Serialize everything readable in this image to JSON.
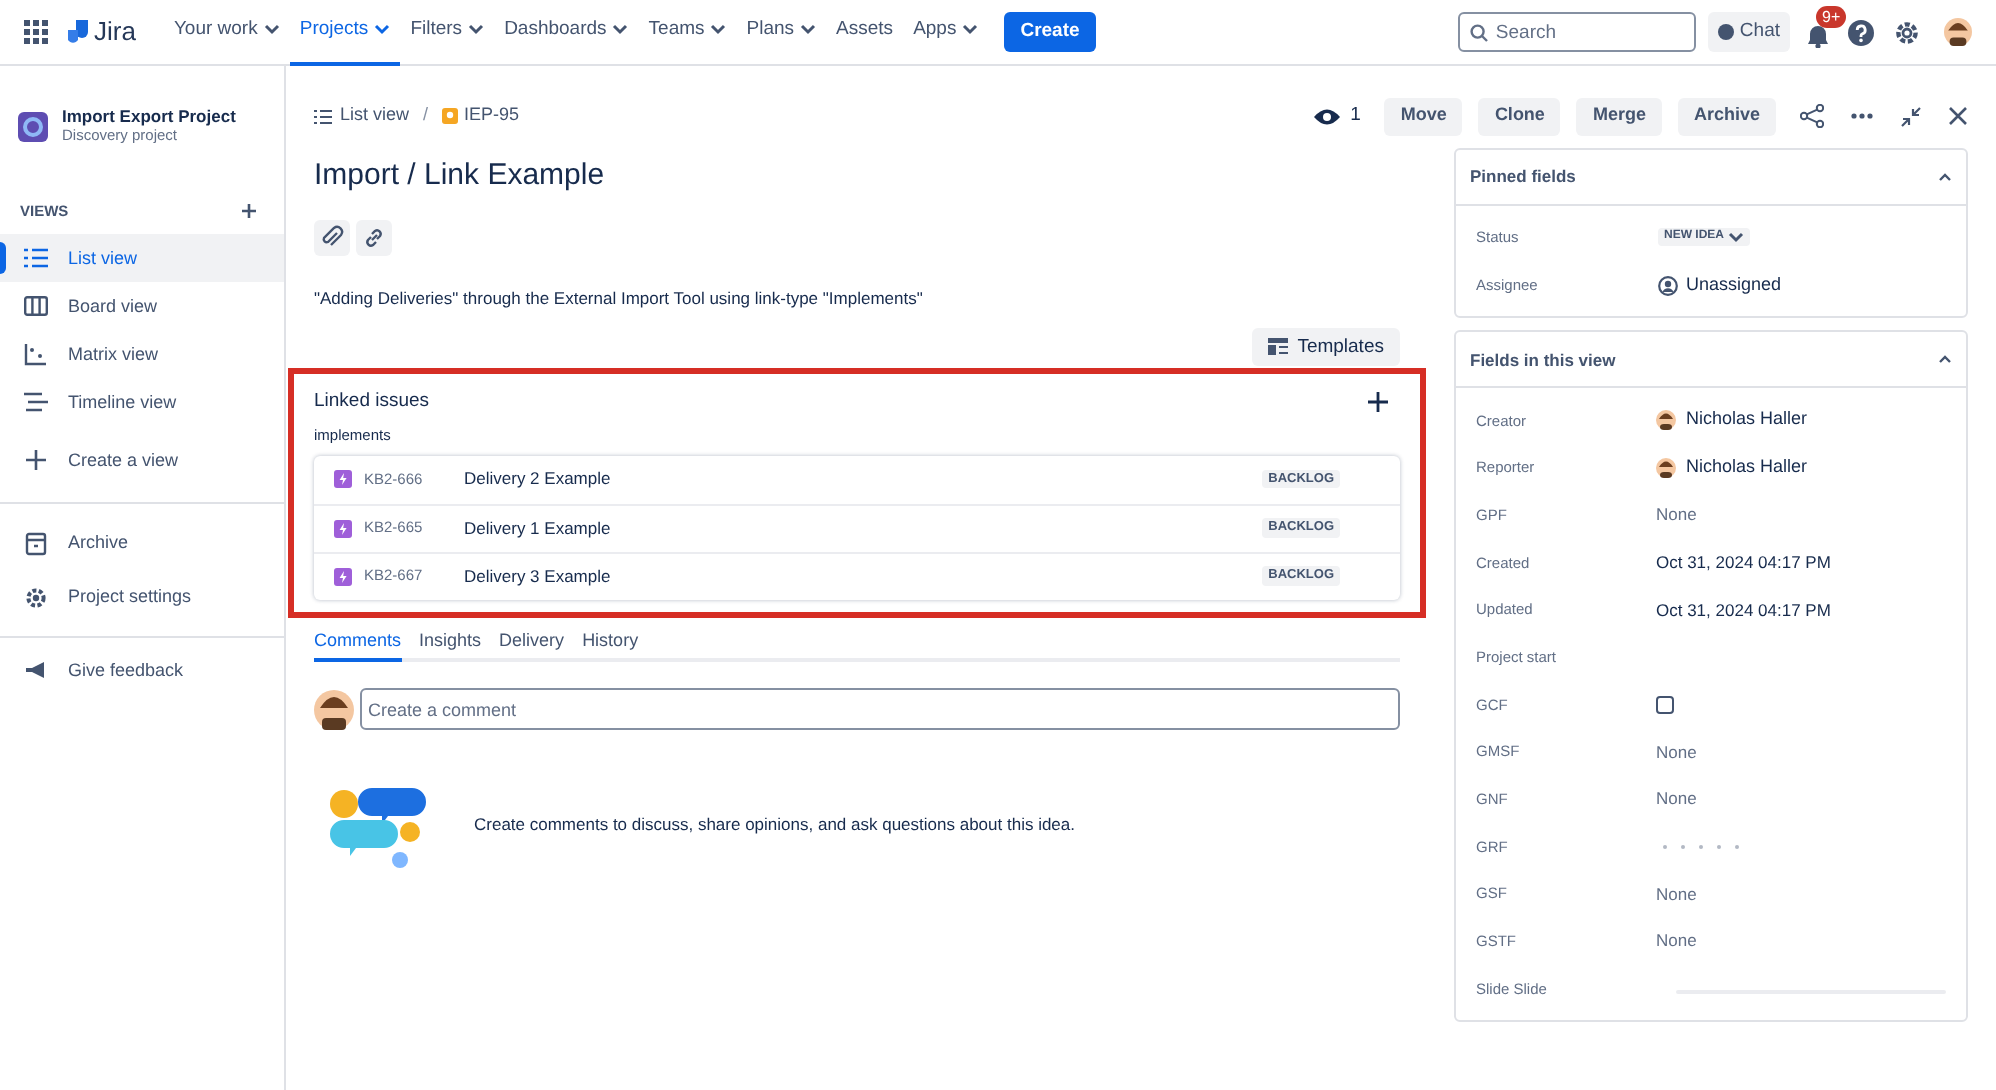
{
  "topnav": {
    "product": "Jira",
    "items": [
      {
        "label": "Your work",
        "dropdown": true,
        "selected": false
      },
      {
        "label": "Projects",
        "dropdown": true,
        "selected": true
      },
      {
        "label": "Filters",
        "dropdown": true,
        "selected": false
      },
      {
        "label": "Dashboards",
        "dropdown": true,
        "selected": false
      },
      {
        "label": "Teams",
        "dropdown": true,
        "selected": false
      },
      {
        "label": "Plans",
        "dropdown": true,
        "selected": false
      },
      {
        "label": "Assets",
        "dropdown": false,
        "selected": false
      },
      {
        "label": "Apps",
        "dropdown": true,
        "selected": false
      }
    ],
    "create": "Create",
    "search": {
      "placeholder": "Search"
    },
    "chat": "Chat",
    "notifications": "9+"
  },
  "sidebar": {
    "project": {
      "name": "Import Export Project",
      "type": "Discovery project"
    },
    "section": "VIEWS",
    "views": [
      {
        "kind": "list",
        "label": "List view",
        "selected": true
      },
      {
        "kind": "board",
        "label": "Board view",
        "selected": false
      },
      {
        "kind": "matrix",
        "label": "Matrix view",
        "selected": false
      },
      {
        "kind": "timeline",
        "label": "Timeline view",
        "selected": false
      },
      {
        "kind": "create",
        "label": "Create a view",
        "selected": false
      }
    ],
    "links": [
      {
        "kind": "archive",
        "label": "Archive"
      },
      {
        "kind": "settings",
        "label": "Project settings"
      }
    ],
    "feedback": "Give feedback"
  },
  "breadcrumb": {
    "view": "List view",
    "separator": "/",
    "issue": "IEP-95"
  },
  "watchers": "1",
  "actions": [
    "Move",
    "Clone",
    "Merge",
    "Archive"
  ],
  "title": "Import / Link Example",
  "description": "\"Adding Deliveries\" through the External Import Tool using link-type \"Implements\"",
  "templates": "Templates",
  "linked_issues": {
    "highlighted": true,
    "title": "Linked issues",
    "link_type": "implements",
    "issues": [
      {
        "key": "KB2-666",
        "summary": "Delivery 2 Example",
        "status": "BACKLOG"
      },
      {
        "key": "KB2-665",
        "summary": "Delivery 1 Example",
        "status": "BACKLOG"
      },
      {
        "key": "KB2-667",
        "summary": "Delivery 3 Example",
        "status": "BACKLOG"
      }
    ]
  },
  "tabs": [
    {
      "label": "Comments",
      "selected": true
    },
    {
      "label": "Insights",
      "selected": false
    },
    {
      "label": "Delivery",
      "selected": false
    },
    {
      "label": "History",
      "selected": false
    }
  ],
  "comment": {
    "placeholder": "Create a comment"
  },
  "empty_comments": "Create comments to discuss, share opinions, and ask questions about this idea.",
  "pinned": {
    "title": "Pinned fields",
    "expanded": true,
    "fields": [
      {
        "kind": "status",
        "label": "Status",
        "value": "NEW IDEA"
      },
      {
        "kind": "assignee",
        "label": "Assignee",
        "value": "Unassigned"
      }
    ]
  },
  "view_fields": {
    "title": "Fields in this view",
    "expanded": true,
    "fields": [
      {
        "kind": "person",
        "label": "Creator",
        "value": "Nicholas Haller"
      },
      {
        "kind": "person",
        "label": "Reporter",
        "value": "Nicholas Haller"
      },
      {
        "kind": "text",
        "label": "GPF",
        "value": "None",
        "muted": true
      },
      {
        "kind": "text",
        "label": "Created",
        "value": "Oct 31, 2024 04:17 PM",
        "muted": false
      },
      {
        "kind": "text",
        "label": "Updated",
        "value": "Oct 31, 2024 04:17 PM",
        "muted": false
      },
      {
        "kind": "empty",
        "label": "Project start"
      },
      {
        "kind": "checkbox",
        "label": "GCF",
        "checked": false
      },
      {
        "kind": "text",
        "label": "GMSF",
        "value": "None",
        "muted": true
      },
      {
        "kind": "text",
        "label": "GNF",
        "value": "None",
        "muted": true
      },
      {
        "kind": "rating",
        "label": "GRF",
        "stars": 0
      },
      {
        "kind": "text",
        "label": "GSF",
        "value": "None",
        "muted": true
      },
      {
        "kind": "text",
        "label": "GSTF",
        "value": "None",
        "muted": true
      },
      {
        "kind": "slider",
        "label": "Slide Slide",
        "level": 0
      }
    ]
  }
}
